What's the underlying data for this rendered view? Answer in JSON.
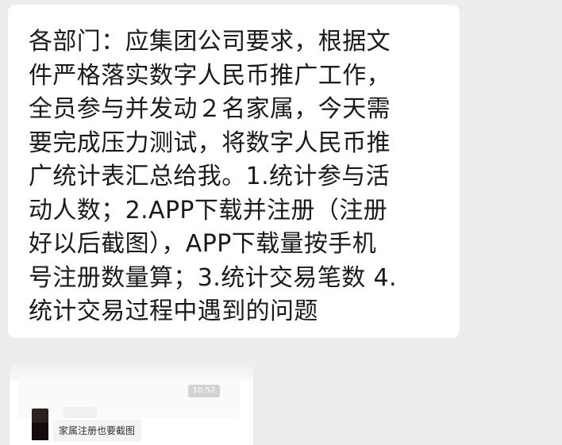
{
  "message": {
    "text": "各部门：应集团公司要求，根据文\n件严格落实数字人民币推广工作，\n全员参与并发动２名家属，今天需\n要完成压力测试，将数字人民币推\n广统计表汇总给我。1.统计参与活\n动人数；2.APP下载并注册（注册\n好以后截图），APP下载量按手机\n号注册数量算；3.统计交易笔数 4.\n统计交易过程中遇到的问题"
  },
  "quoted_message": {
    "time": "10:52",
    "caption": "家属注册也要截图"
  },
  "colors": {
    "background": "#ededed",
    "bubble": "#ffffff",
    "text": "#1a1a1a",
    "time_badge": "#d2d2d2"
  }
}
